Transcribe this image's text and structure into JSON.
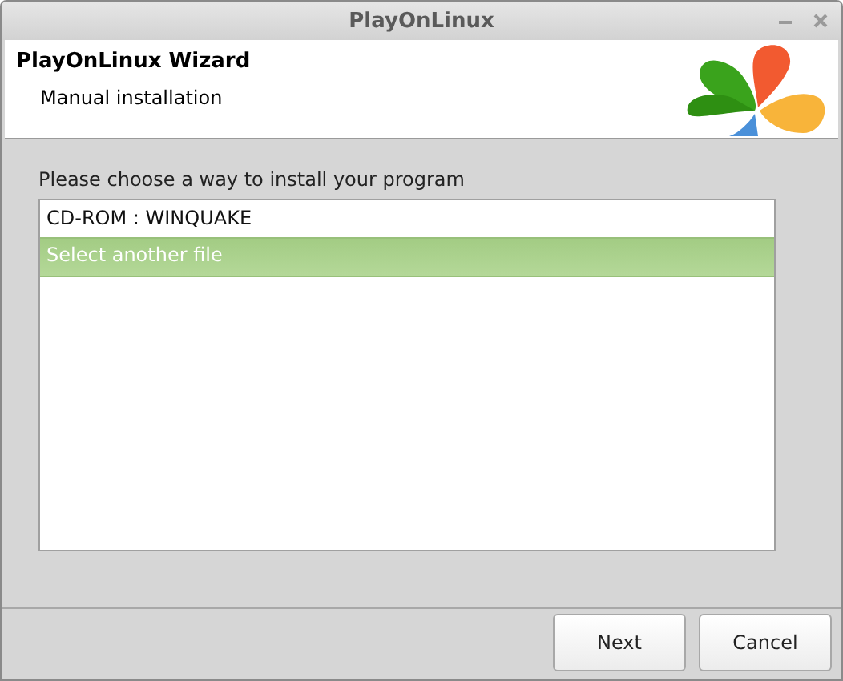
{
  "window": {
    "title": "PlayOnLinux"
  },
  "header": {
    "title": "PlayOnLinux Wizard",
    "subtitle": "Manual installation"
  },
  "prompt": "Please choose a way to install your program",
  "options": [
    {
      "label": "CD-ROM : WINQUAKE",
      "selected": false
    },
    {
      "label": "Select another file",
      "selected": true
    }
  ],
  "buttons": [
    "Next",
    "Cancel"
  ]
}
